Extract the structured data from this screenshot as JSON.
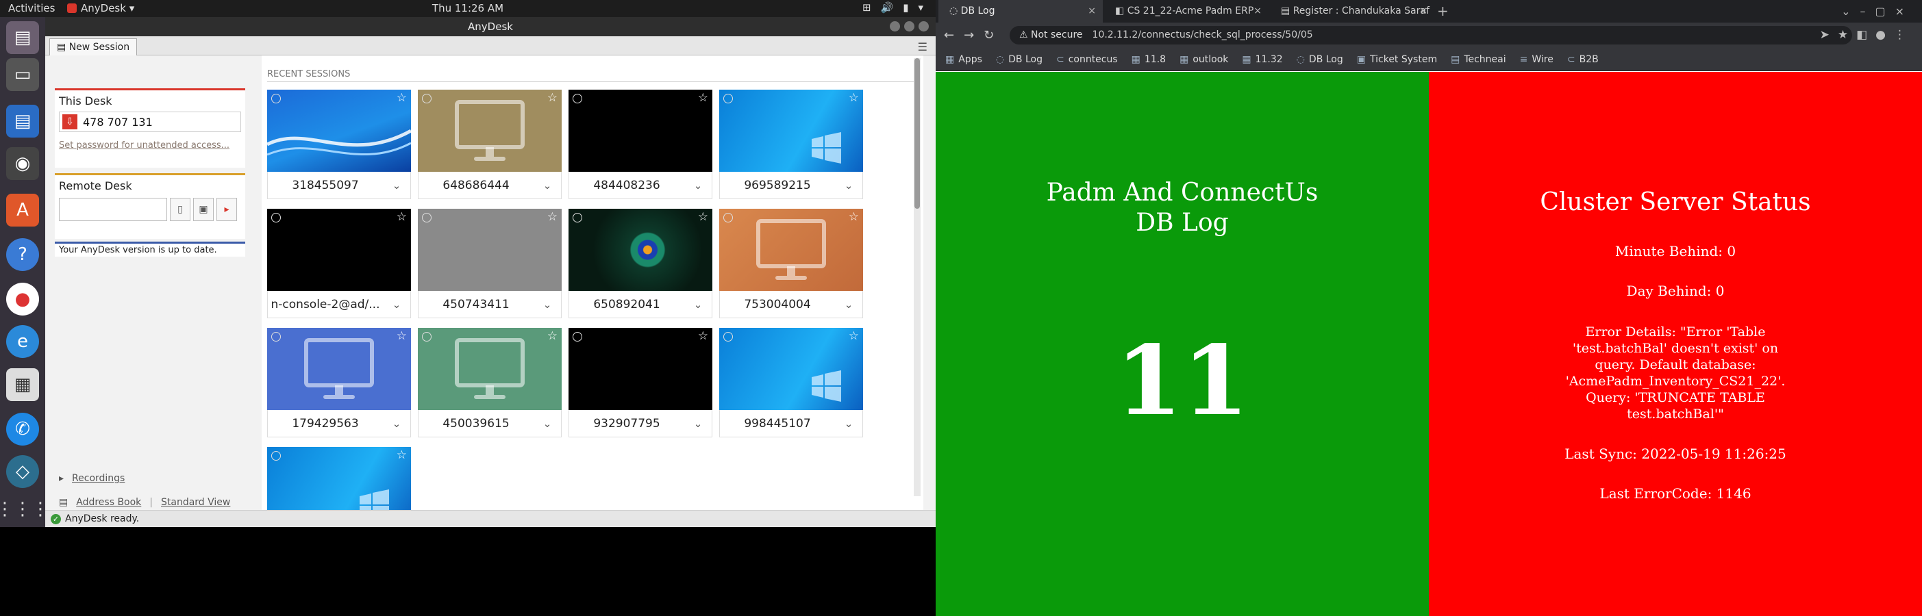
{
  "topbar": {
    "activities": "Activities",
    "app_name": "AnyDesk ▾",
    "clock": "Thu 11:26 AM"
  },
  "anydesk": {
    "window_title": "AnyDesk",
    "tab_label": "New Session",
    "this_desk": {
      "title": "This Desk",
      "id": "478 707 131",
      "link": "Set password for unattended access..."
    },
    "remote_desk": {
      "title": "Remote Desk"
    },
    "update_msg": "Your AnyDesk version is up to date.",
    "recordings": "Recordings",
    "address_book": "Address Book",
    "standard_view": "Standard View",
    "recent_label": "RECENT SESSIONS",
    "status": "AnyDesk ready.",
    "sessions": [
      {
        "label": "318455097",
        "thumb": "blue-wave"
      },
      {
        "label": "648686444",
        "thumb": "monitor-tan"
      },
      {
        "label": "484408236",
        "thumb": "black"
      },
      {
        "label": "969589215",
        "thumb": "windows"
      },
      {
        "label": "n-console-2@ad/...",
        "thumb": "black"
      },
      {
        "label": "450743411",
        "thumb": "grey"
      },
      {
        "label": "650892041",
        "thumb": "peacock"
      },
      {
        "label": "753004004",
        "thumb": "monitor-orange"
      },
      {
        "label": "179429563",
        "thumb": "monitor-blue"
      },
      {
        "label": "450039615",
        "thumb": "monitor-green"
      },
      {
        "label": "932907795",
        "thumb": "black"
      },
      {
        "label": "998445107",
        "thumb": "windows"
      },
      {
        "label": "",
        "thumb": "windows"
      }
    ]
  },
  "chrome": {
    "tabs": [
      {
        "label": "DB Log",
        "close": "×"
      },
      {
        "label": "CS 21_22-Acme Padm ERP",
        "close": "×"
      },
      {
        "label": "Register : Chandukaka Saraf",
        "close": "×"
      }
    ],
    "not_secure": "⚠ Not secure",
    "url": "10.2.11.2/connectus/check_sql_process/50/05",
    "bookmarks": [
      "Apps",
      "DB Log",
      "conntecus",
      "11.8",
      "outlook",
      "11.32",
      "DB Log",
      "Ticket System",
      "Techneai",
      "Wire",
      "B2B"
    ]
  },
  "dblog": {
    "heading_line1": "Padm And ConnectUs",
    "heading_line2": "DB Log",
    "count": "11"
  },
  "cluster": {
    "heading": "Cluster Server Status",
    "minute_behind": "Minute Behind: 0",
    "day_behind": "Day Behind: 0",
    "error_details": "Error Details: \"Error 'Table 'test.batchBal' doesn't exist' on query. Default database: 'AcmePadm_Inventory_CS21_22'. Query: 'TRUNCATE TABLE test.batchBal'\"",
    "last_sync": "Last Sync: 2022-05-19 11:26:25",
    "last_error_code": "Last ErrorCode: 1146"
  },
  "colors": {
    "dblog_bg": "#0a9a0a",
    "cluster_bg": "#ff0000",
    "anydesk_red": "#d9362b"
  }
}
